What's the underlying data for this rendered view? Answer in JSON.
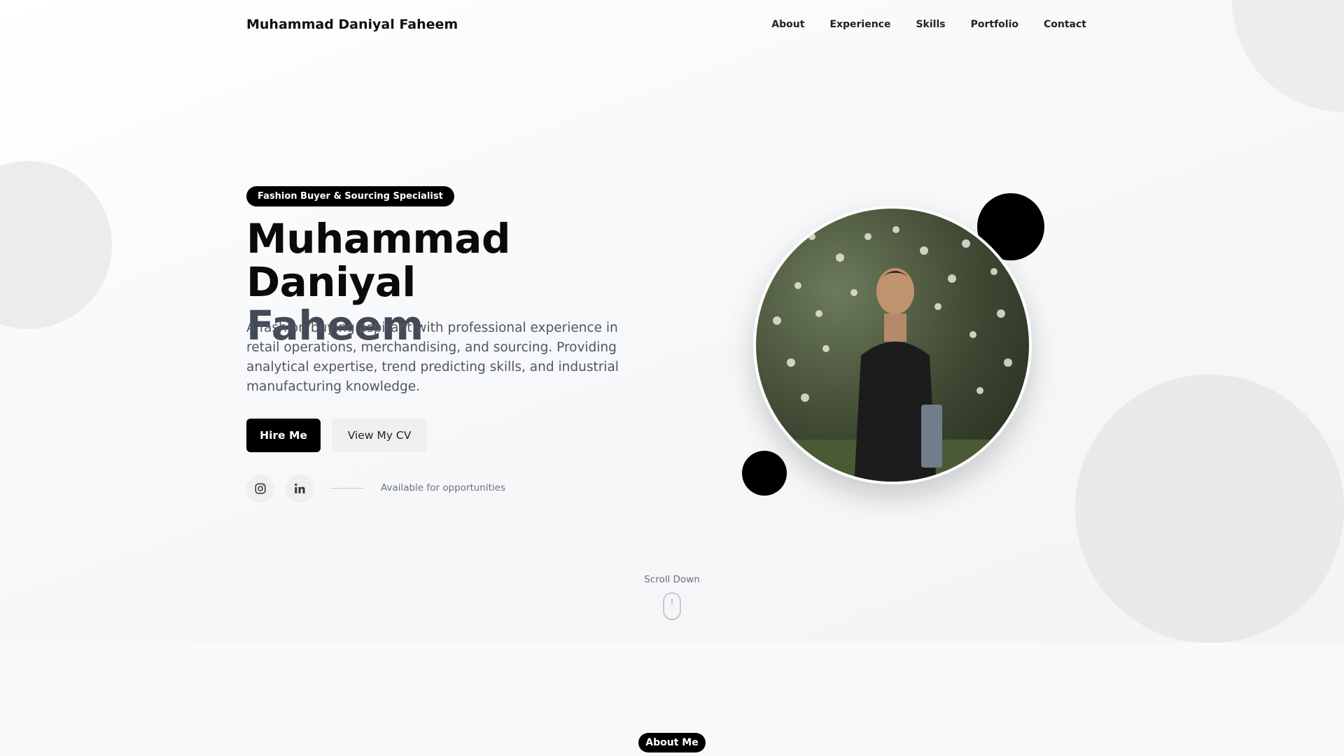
{
  "nav": {
    "brand": "Muhammad Daniyal Faheem",
    "links": [
      "About",
      "Experience",
      "Skills",
      "Portfolio",
      "Contact"
    ]
  },
  "hero": {
    "badge": "Fashion Buyer & Sourcing Specialist",
    "name_line1": "Muhammad Daniyal",
    "name_line2": "Faheem",
    "description": "A fashion buying aspirant with professional experience in retail operations, merchandising, and sourcing. Providing analytical expertise, trend predicting skills, and industrial manufacturing knowledge.",
    "primary_button": "Hire Me",
    "secondary_button": "View My CV",
    "availability": "Available for opportunities",
    "social_icons": [
      "instagram-icon",
      "linkedin-icon"
    ],
    "photo_icon": "profile-photo"
  },
  "scroll": {
    "label": "Scroll Down",
    "icon": "mouse-icon"
  },
  "about": {
    "pill": "About Me"
  },
  "colors": {
    "accent": "#000000",
    "surname": "#434a57",
    "background": "#f8f9fb"
  }
}
